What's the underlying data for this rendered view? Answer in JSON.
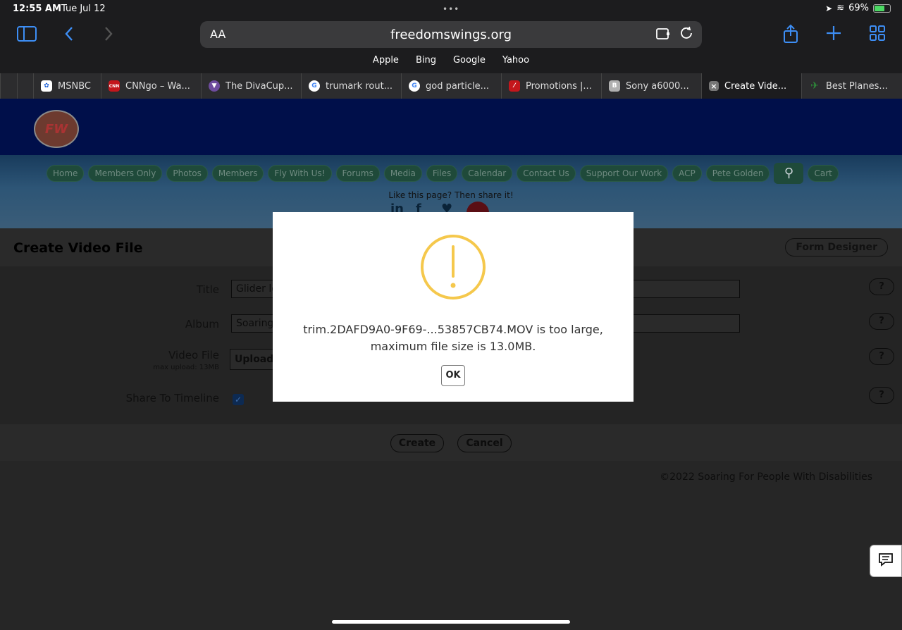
{
  "status_bar": {
    "time": "12:55 AM",
    "date": "Tue Jul 12",
    "battery": "69%"
  },
  "toolbar": {
    "aa_label": "AA",
    "url": "freedomswings.org"
  },
  "favorites": [
    "Apple",
    "Bing",
    "Google",
    "Yahoo"
  ],
  "tabs": [
    {
      "label": "MSNBC",
      "color": "#1a5fd6",
      "glyph": "M"
    },
    {
      "label": "CNNgo – Wa...",
      "color": "#c4161c",
      "glyph": "CNN"
    },
    {
      "label": "The DivaCup...",
      "color": "#6e4c9e",
      "glyph": "V"
    },
    {
      "label": "trumark rout...",
      "color": "#ffffff",
      "glyph": "G"
    },
    {
      "label": "god particle...",
      "color": "#ffffff",
      "glyph": "G"
    },
    {
      "label": "Promotions |...",
      "color": "#c4161c",
      "glyph": "/"
    },
    {
      "label": "Sony a6000...",
      "color": "#b0b0b0",
      "glyph": "B"
    },
    {
      "label": "Create Vide...",
      "color": "#777777",
      "glyph": "×"
    },
    {
      "label": "Best Planes...",
      "color": "#2e8b3a",
      "glyph": "✈"
    }
  ],
  "site": {
    "logo_text": "FW",
    "nav": [
      "Home",
      "Members Only",
      "Photos",
      "Members",
      "Fly With Us!",
      "Forums",
      "Media",
      "Files",
      "Calendar",
      "Contact Us",
      "Support Our Work",
      "ACP",
      "Pete Golden",
      "Cart"
    ],
    "share_text": "Like this page? Then share it!",
    "page_title": "Create Video File",
    "form_designer": "Form Designer",
    "fields": {
      "title_label": "Title",
      "title_value": "Glider lo",
      "album_label": "Album",
      "album_value": "Soaring",
      "video_label": "Video File",
      "video_sub": "max upload: 13MB",
      "upload_label": "Upload",
      "share_label": "Share To Timeline"
    },
    "help_label": "?",
    "create_label": "Create",
    "cancel_label": "Cancel",
    "footer": "©2022 Soaring For People With Disabilities"
  },
  "modal": {
    "line1": "trim.2DAFD9A0-9F69-...53857CB74.MOV is too large,",
    "line2": "maximum file size is 13.0MB.",
    "ok_label": "OK",
    "accent": "#f5c84c"
  }
}
